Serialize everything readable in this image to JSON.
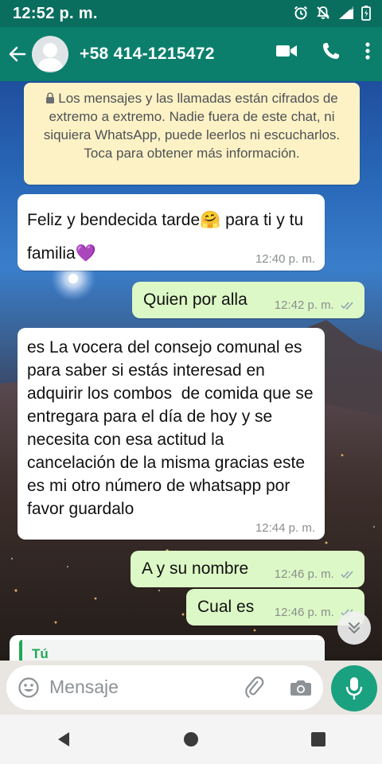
{
  "status_bar": {
    "time": "12:52 p. m.",
    "network": "4G",
    "icons": [
      "alarm-icon",
      "mute-icon",
      "signal-icon",
      "battery-icon"
    ]
  },
  "header": {
    "contact_name": "+58 414-1215472",
    "icons": [
      "back-arrow-icon",
      "avatar-icon",
      "video-call-icon",
      "phone-icon",
      "more-options-icon"
    ]
  },
  "chat": {
    "encryption_notice": "Los mensajes y las llamadas están cifrados de extremo a extremo. Nadie fuera de este chat, ni siquiera WhatsApp, puede leerlos ni escucharlos. Toca para obtener más información.",
    "messages": [
      {
        "direction": "incoming",
        "text": "Feliz y bendecida tarde🤗 para ti y tu familia💜",
        "time": "12:40 p. m."
      },
      {
        "direction": "outgoing",
        "text": "Quien por alla",
        "time": "12:42 p. m.",
        "status": "read"
      },
      {
        "direction": "incoming",
        "text": "es La vocera del consejo comunal es para saber si estás interesad en adquirir los combos  de comida que se entregara para el día de hoy y se necesita con esa actitud la cancelación de la misma gracias este es mi otro número de whatsapp por favor guardalo",
        "time": "12:44 p. m."
      },
      {
        "direction": "outgoing",
        "text": "A y su nombre",
        "time": "12:46 p. m.",
        "status": "read"
      },
      {
        "direction": "outgoing",
        "text": "Cual es",
        "time": "12:46 p. m.",
        "status": "read"
      }
    ],
    "reply_preview_author": "Tú"
  },
  "composer": {
    "placeholder": "Mensaje",
    "icons": [
      "emoji-icon",
      "attach-icon",
      "camera-icon",
      "mic-icon"
    ]
  },
  "colors": {
    "header": "#0b7f6c",
    "status_bar": "#0a6e5f",
    "outgoing_bubble": "#dcf8c6",
    "incoming_bubble": "#ffffff",
    "encryption_bg": "#fdf2c5",
    "accent": "#1aa180",
    "read_ticks": "#8ea6b3"
  }
}
